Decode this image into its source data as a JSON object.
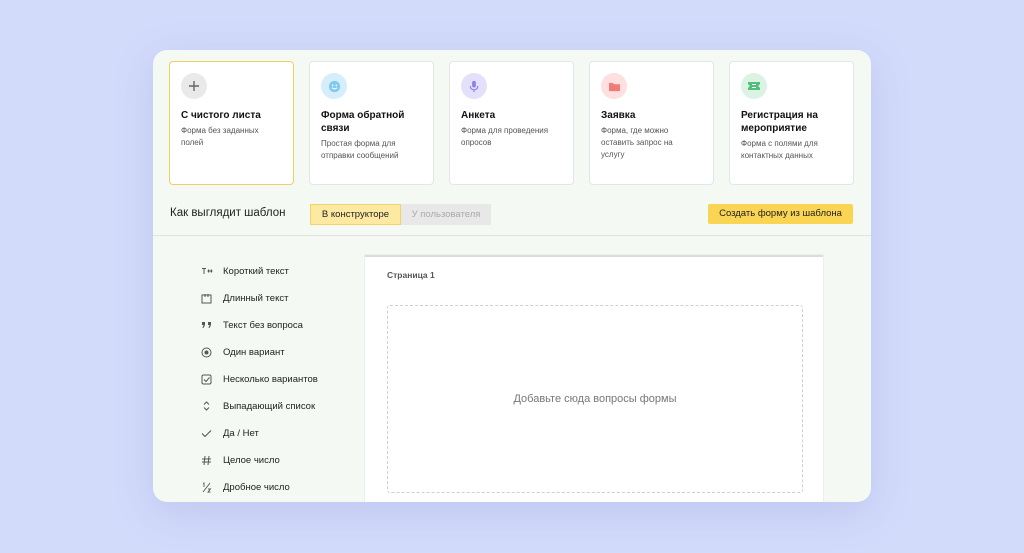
{
  "templates": [
    {
      "title_lines": [
        "С чистого листа"
      ],
      "desc_lines": [
        "Форма без заданных",
        "полей"
      ],
      "icon": "plus-icon",
      "color": "#e9e9e9",
      "selected": true
    },
    {
      "title_lines": [
        "Форма обратной",
        "связи"
      ],
      "desc_lines": [
        "Простая форма для",
        "отправки сообщений"
      ],
      "icon": "smile-icon",
      "color": "#d6eefb"
    },
    {
      "title_lines": [
        "Анкета"
      ],
      "desc_lines": [
        "Форма для проведения",
        "опросов"
      ],
      "icon": "microphone-icon",
      "color": "#e3e0fb"
    },
    {
      "title_lines": [
        "Заявка"
      ],
      "desc_lines": [
        "Форма, где можно",
        "оставить запрос на",
        "услугу"
      ],
      "icon": "folder-icon",
      "color": "#fde0df"
    },
    {
      "title_lines": [
        "Регистрация на",
        "мероприятие"
      ],
      "desc_lines": [
        "Форма с полями для",
        "контактных данных"
      ],
      "icon": "ticket-icon",
      "color": "#dcf3e3"
    }
  ],
  "view": {
    "label": "Как выглядит шаблон",
    "tab_builder": "В конструкторе",
    "tab_user": "У пользователя",
    "create_button": "Создать форму из шаблона"
  },
  "question_types": [
    {
      "label": "Короткий текст",
      "icon": "short-text-icon"
    },
    {
      "label": "Длинный текст",
      "icon": "long-text-icon"
    },
    {
      "label": "Текст без вопроса",
      "icon": "quote-icon"
    },
    {
      "label": "Один вариант",
      "icon": "radio-icon"
    },
    {
      "label": "Несколько вариантов",
      "icon": "checkbox-icon"
    },
    {
      "label": "Выпадающий список",
      "icon": "dropdown-icon"
    },
    {
      "label": "Да / Нет",
      "icon": "check-icon"
    },
    {
      "label": "Целое число",
      "icon": "hash-icon"
    },
    {
      "label": "Дробное число",
      "icon": "fraction-icon"
    }
  ],
  "page": {
    "title": "Страница 1",
    "placeholder": "Добавьте сюда вопросы формы"
  }
}
